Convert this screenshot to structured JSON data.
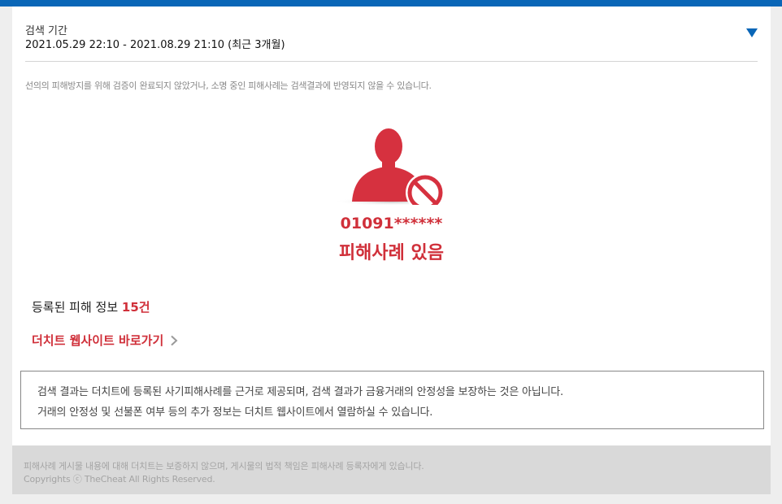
{
  "search_period": {
    "label": "검색 기간",
    "value": "2021.05.29 22:10 - 2021.08.29 21:10 (최근 3개월)",
    "toggle_icon": "triangle-down-icon"
  },
  "notice": "선의의 피해방지를 위해 검증이 완료되지 않았거나, 소명 중인 피해사례는 검색결과에 반영되지 않을 수 있습니다.",
  "result": {
    "icon": "person-blocked-icon",
    "number": "01091******",
    "status": "피해사례 있음"
  },
  "registered": {
    "label": "등록된 피해 정보 ",
    "count": "15건"
  },
  "site_link": {
    "label": "더치트 웹사이트 바로가기",
    "icon": "chevron-right-icon"
  },
  "info_box": {
    "line1": "검색 결과는 더치트에 등록된 사기피해사례를 근거로 제공되며, 검색 결과가 금융거래의 안정성을 보장하는 것은 아닙니다.",
    "line2": "거래의 안정성 및 선불폰 여부 등의 추가 정보는 더치트 웹사이트에서 열람하실 수 있습니다."
  },
  "footer": {
    "disclaimer": "피해사례 게시물 내용에 대해 더치트는 보증하지 않으며, 게시물의 법적 책임은 피해사례 등록자에게 있습니다.",
    "copyright": "Copyrights ⓒ TheCheat All Rights Reserved."
  },
  "colors": {
    "accent": "#d0303a",
    "top_bar": "#0a66b7",
    "arrow": "#0a66b7"
  }
}
